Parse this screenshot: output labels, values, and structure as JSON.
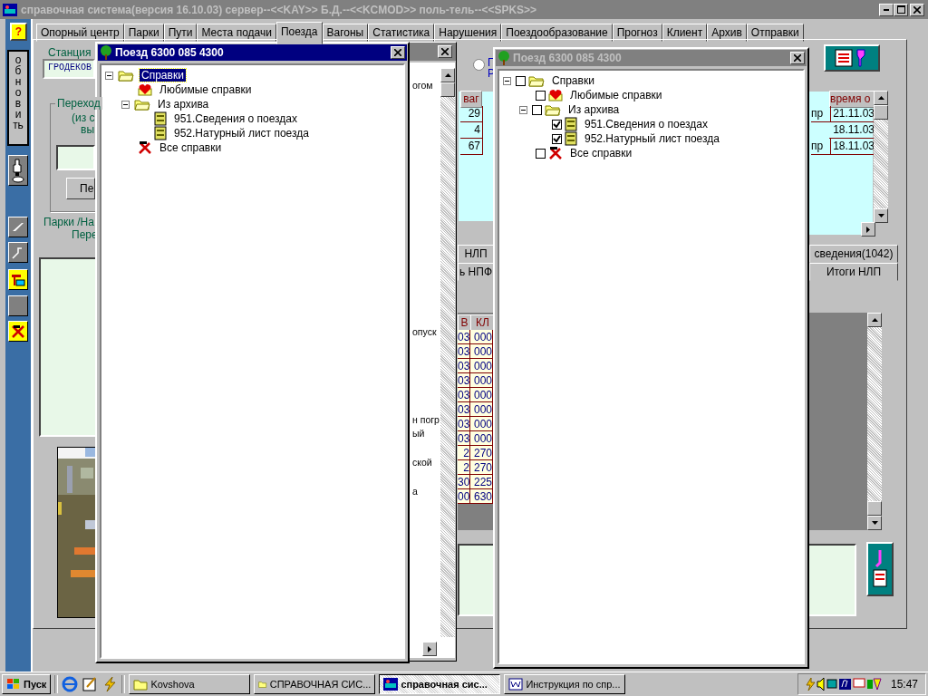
{
  "window": {
    "title": "справочная система(версия 16.10.03) сервер--<<KAY>> Б.Д.--<<KCMOD>> поль-тель--<<SPKS>>"
  },
  "toolbar": {
    "help": "?",
    "refresh": "обновить"
  },
  "tabs": [
    {
      "label": "Опорный центр",
      "selected": false
    },
    {
      "label": "Парки",
      "selected": false
    },
    {
      "label": "Пути",
      "selected": false
    },
    {
      "label": "Места подачи",
      "selected": false
    },
    {
      "label": "Поезда",
      "selected": true
    },
    {
      "label": "Вагоны",
      "selected": false
    },
    {
      "label": "Статистика",
      "selected": false
    },
    {
      "label": "Нарушения",
      "selected": false
    },
    {
      "label": "Поездообразование",
      "selected": false
    },
    {
      "label": "Прогноз",
      "selected": false
    },
    {
      "label": "Клиент",
      "selected": false
    },
    {
      "label": "Архив",
      "selected": false
    },
    {
      "label": "Отправки",
      "selected": false
    }
  ],
  "station": {
    "label": "Станция",
    "value": "ГРОДЕКОВ"
  },
  "transition": {
    "legend": "Переход",
    "note_1": "(из с",
    "note_2": "вы",
    "button": "Пе"
  },
  "parks": {
    "label_1": "Парки /На",
    "label_2": "Пере"
  },
  "radio": {
    "selected": false,
    "label_1": "Г",
    "label_2": "Р"
  },
  "behind_window": {
    "lines": [
      "огом",
      "опуск",
      "н погр",
      "ый",
      "ской",
      "а"
    ]
  },
  "upper_grid": {
    "columns": [
      "ваг",
      "время о"
    ],
    "rows": [
      {
        "wagons": "29",
        "column_2": "пр",
        "time": "21.11.03"
      },
      {
        "wagons": "4",
        "time": "18.11.03"
      },
      {
        "wagons": "67",
        "column_2": "пр",
        "time": "18.11.03"
      }
    ]
  },
  "lower_tabs": {
    "row_1": [
      "НЛП",
      "сведения(1042)"
    ],
    "row_2": [
      "ь НПФ",
      "Итоги НЛП"
    ]
  },
  "lower_grid": {
    "columns": [
      "В",
      "КЛ"
    ],
    "rows": [
      [
        "03",
        "000"
      ],
      [
        "03",
        "000"
      ],
      [
        "03",
        "000"
      ],
      [
        "03",
        "000"
      ],
      [
        "03",
        "000"
      ],
      [
        "03",
        "000"
      ],
      [
        "03",
        "000"
      ],
      [
        "03",
        "000"
      ],
      [
        "2",
        "270"
      ],
      [
        "2",
        "270"
      ],
      [
        "30",
        "225"
      ],
      [
        "00",
        "630"
      ]
    ]
  },
  "tree_windows": [
    {
      "title": "Поезд 6300 085 4300",
      "active": true,
      "tree": [
        {
          "label": "Справки",
          "kind": "folder",
          "selected": true,
          "expanded": true,
          "children": [
            {
              "label": "Любимые справки",
              "kind": "favorites",
              "selected": false
            },
            {
              "label": "Из архива",
              "kind": "folder",
              "selected": false,
              "expanded": true,
              "children": [
                {
                  "label": "951.Сведения о поездах",
                  "kind": "report",
                  "selected": false
                },
                {
                  "label": "952.Натурный лист поезда",
                  "kind": "report",
                  "selected": false
                }
              ]
            },
            {
              "label": "Все справки",
              "kind": "tools",
              "selected": false
            }
          ]
        }
      ]
    },
    {
      "title": "Поезд 6300 085 4300",
      "active": false,
      "tree": [
        {
          "label": "Справки",
          "kind": "folder",
          "selected": false,
          "checked": false,
          "expanded": true,
          "children": [
            {
              "label": "Любимые справки",
              "kind": "favorites",
              "selected": false,
              "checked": false
            },
            {
              "label": "Из архива",
              "kind": "folder",
              "selected": false,
              "checked": false,
              "expanded": true,
              "children": [
                {
                  "label": "951.Сведения о поездах",
                  "kind": "report",
                  "selected": false,
                  "checked": true
                },
                {
                  "label": "952.Натурный лист поезда",
                  "kind": "report",
                  "selected": false,
                  "checked": true
                }
              ]
            },
            {
              "label": "Все справки",
              "kind": "tools",
              "selected": false,
              "checked": false
            }
          ]
        }
      ]
    }
  ],
  "taskbar": {
    "start": "Пуск",
    "tasks": [
      {
        "label": "Kovshova",
        "kind": "folder",
        "selected": false
      },
      {
        "label": "СПРАВОЧНАЯ СИС...",
        "kind": "folder",
        "selected": false
      },
      {
        "label": "справочная сис...",
        "kind": "app",
        "selected": true
      },
      {
        "label": "Инструкция по спр...",
        "kind": "word",
        "selected": false
      }
    ],
    "clock": "15:47"
  }
}
